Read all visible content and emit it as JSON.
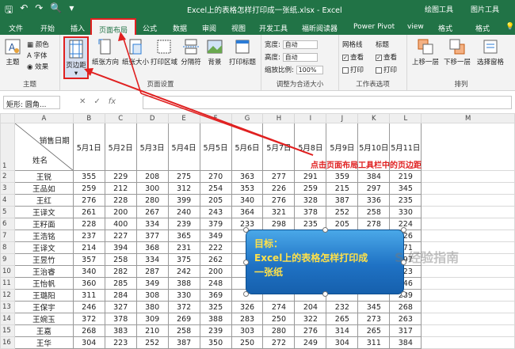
{
  "window": {
    "title": "Excel上的表格怎样打印成一张纸.xlsx  -  Excel",
    "context_tabs": [
      "绘图工具",
      "图片工具"
    ]
  },
  "tabs": [
    "文件",
    "开始",
    "插入",
    "页面布局",
    "公式",
    "数据",
    "审阅",
    "视图",
    "开发工具",
    "福昕阅读器",
    "Power Pivot",
    "view",
    "格式",
    "格式"
  ],
  "ribbon": {
    "theme": {
      "group": "主题",
      "themes": "主题",
      "colors": "颜色",
      "fonts": "字体",
      "effects": "效果"
    },
    "page_setup": {
      "group": "页面设置",
      "margins": "页边距",
      "orientation": "纸张方向",
      "size": "纸张大小",
      "print_area": "打印区域",
      "breaks": "分隔符",
      "background": "背景",
      "print_titles": "打印标题"
    },
    "scale": {
      "group": "调整为合适大小",
      "width_label": "宽度:",
      "width_value": "自动",
      "height_label": "高度:",
      "height_value": "自动",
      "scale_label": "缩放比例:",
      "scale_value": "100%"
    },
    "sheet_options": {
      "group": "工作表选项",
      "gridlines": "网格线",
      "headings": "标题",
      "view": "查看",
      "print": "打印"
    },
    "arrange": {
      "group": "排列",
      "bring_forward": "上移一层",
      "send_backward": "下移一层",
      "selection_pane": "选择窗格"
    }
  },
  "formula_bar": {
    "name_box": "矩形: 圆角...",
    "fx": "fx"
  },
  "sheet": {
    "columns": [
      "A",
      "B",
      "C",
      "D",
      "E",
      "F",
      "G",
      "H",
      "I",
      "J",
      "K",
      "L",
      "M"
    ],
    "header": {
      "corner_top": "销售日期",
      "corner_bottom": "姓名",
      "dates": [
        "5月1日",
        "5月2日",
        "5月3日",
        "5月4日",
        "5月5日",
        "5月6日",
        "5月7日",
        "5月8日",
        "5月9日",
        "5月10日",
        "5月11日"
      ]
    },
    "rows": [
      {
        "n": "2",
        "name": "王锐",
        "v": [
          "355",
          "229",
          "208",
          "275",
          "270",
          "363",
          "277",
          "291",
          "359",
          "384",
          "219"
        ]
      },
      {
        "n": "3",
        "name": "王品如",
        "v": [
          "259",
          "212",
          "300",
          "312",
          "254",
          "353",
          "226",
          "259",
          "215",
          "297",
          "345"
        ]
      },
      {
        "n": "4",
        "name": "王红",
        "v": [
          "276",
          "228",
          "280",
          "399",
          "205",
          "340",
          "276",
          "328",
          "387",
          "336",
          "235"
        ]
      },
      {
        "n": "5",
        "name": "王译文",
        "v": [
          "261",
          "200",
          "267",
          "240",
          "243",
          "364",
          "321",
          "378",
          "252",
          "258",
          "330"
        ]
      },
      {
        "n": "6",
        "name": "王籽面",
        "v": [
          "228",
          "400",
          "334",
          "239",
          "379",
          "233",
          "298",
          "235",
          "205",
          "278",
          "224"
        ]
      },
      {
        "n": "7",
        "name": "王浩铭",
        "v": [
          "237",
          "227",
          "377",
          "365",
          "349",
          "",
          "",
          "",
          "",
          "",
          "226"
        ]
      },
      {
        "n": "8",
        "name": "王译文",
        "v": [
          "214",
          "394",
          "368",
          "231",
          "222",
          "",
          "",
          "",
          "",
          "",
          "271"
        ]
      },
      {
        "n": "9",
        "name": "王昱竹",
        "v": [
          "357",
          "258",
          "334",
          "375",
          "262",
          "",
          "",
          "",
          "",
          "",
          "297"
        ]
      },
      {
        "n": "10",
        "name": "王治睿",
        "v": [
          "340",
          "282",
          "287",
          "242",
          "200",
          "",
          "",
          "",
          "",
          "",
          "223"
        ]
      },
      {
        "n": "11",
        "name": "王怡帆",
        "v": [
          "360",
          "285",
          "349",
          "388",
          "248",
          "",
          "",
          "",
          "",
          "",
          "346"
        ]
      },
      {
        "n": "12",
        "name": "王璐阳",
        "v": [
          "311",
          "284",
          "308",
          "330",
          "369",
          "",
          "",
          "",
          "",
          "",
          "289"
        ]
      },
      {
        "n": "13",
        "name": "王保宇",
        "v": [
          "246",
          "327",
          "380",
          "372",
          "325",
          "326",
          "274",
          "204",
          "232",
          "345",
          "268"
        ]
      },
      {
        "n": "14",
        "name": "王婉玉",
        "v": [
          "372",
          "378",
          "309",
          "269",
          "388",
          "283",
          "250",
          "322",
          "265",
          "273",
          "263"
        ]
      },
      {
        "n": "15",
        "name": "王嘉",
        "v": [
          "268",
          "383",
          "210",
          "258",
          "239",
          "303",
          "280",
          "276",
          "314",
          "265",
          "317"
        ]
      },
      {
        "n": "16",
        "name": "王华",
        "v": [
          "304",
          "223",
          "252",
          "387",
          "350",
          "250",
          "272",
          "249",
          "304",
          "311",
          "384"
        ]
      }
    ]
  },
  "annotation": "点击页面布局工具栏中的页边距",
  "note": {
    "line1": "目标：",
    "line2": "Excel上的表格怎样打印成",
    "line3": "一张纸"
  },
  "watermark": "S 经验指南"
}
